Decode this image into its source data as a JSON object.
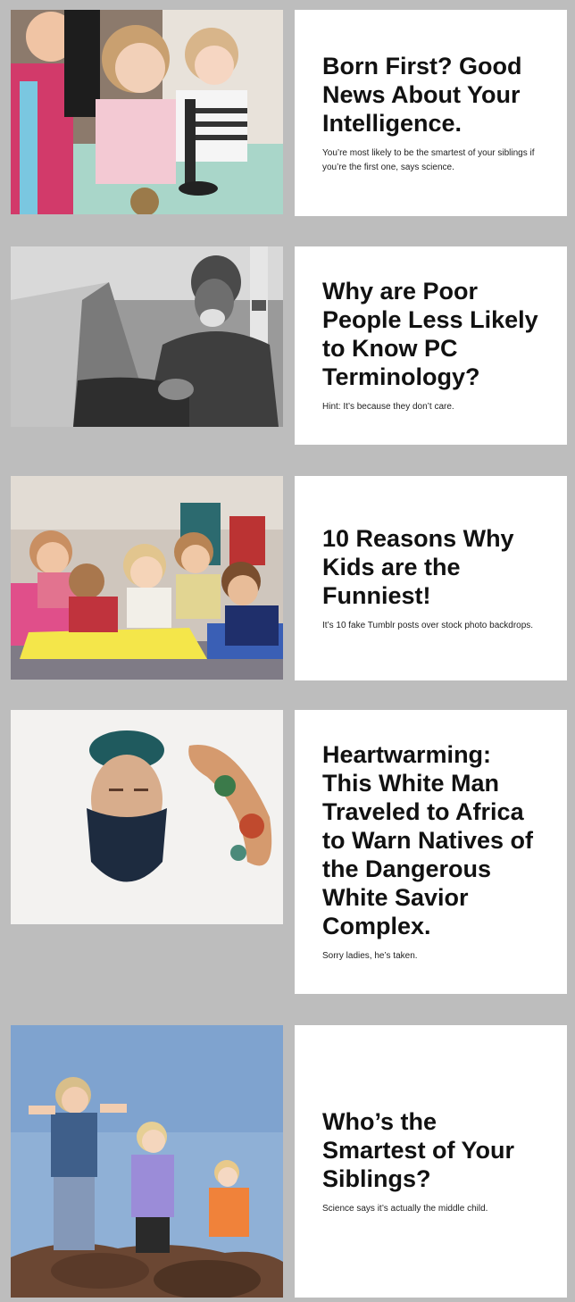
{
  "articles": [
    {
      "title": "Born First? Good News About Your Intelligence.",
      "subtitle": "You’re most likely to be the smartest of your siblings if you’re the first one, says science.",
      "image": "three-children-with-microscope-photo"
    },
    {
      "title": "Why are Poor People Less Likely to Know PC Terminology?",
      "subtitle": "Hint: It’s because they don’t care.",
      "image": "elderly-man-sitting-on-street-photo"
    },
    {
      "title": "10 Reasons Why Kids are the Funniest!",
      "subtitle": "It’s 10 fake Tumblr posts over stock photo backdrops.",
      "image": "kids-lying-on-play-mat-photo"
    },
    {
      "title": "Heartwarming: This White Man Traveled to Africa to Warn Natives of the Dangerous White Savior Complex.",
      "subtitle": "Sorry ladies, he’s taken.",
      "image": "bearded-man-in-white-bath-photo"
    },
    {
      "title": "Who’s the Smartest of Your Siblings?",
      "subtitle": "Science says it’s actually the middle child.",
      "image": "three-siblings-on-rock-photo"
    }
  ],
  "colors": {
    "page_background": "#bdbdbd",
    "card_background": "#ffffff",
    "title_text": "#111111"
  }
}
